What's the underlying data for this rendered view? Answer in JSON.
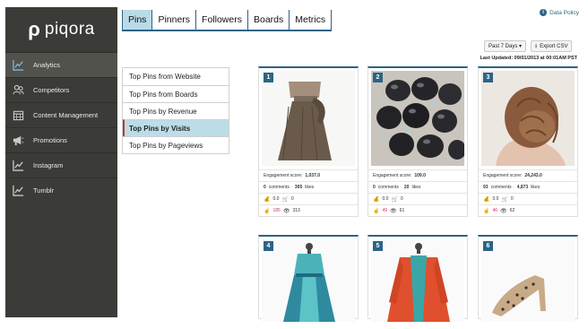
{
  "brand": {
    "logo_mark": "ρ",
    "logo_text": "piqora"
  },
  "sidebar": {
    "items": [
      {
        "label": "Analytics",
        "icon": "line-chart-icon",
        "active": true
      },
      {
        "label": "Competitors",
        "icon": "users-icon",
        "active": false
      },
      {
        "label": "Content Management",
        "icon": "calendar-icon",
        "active": false
      },
      {
        "label": "Promotions",
        "icon": "megaphone-icon",
        "active": false
      },
      {
        "label": "Instagram",
        "icon": "line-chart-icon",
        "active": false
      },
      {
        "label": "Tumblr",
        "icon": "line-chart-icon",
        "active": false
      }
    ]
  },
  "tabs": [
    {
      "label": "Pins",
      "active": true
    },
    {
      "label": "Pinners",
      "active": false
    },
    {
      "label": "Followers",
      "active": false
    },
    {
      "label": "Boards",
      "active": false
    },
    {
      "label": "Metrics",
      "active": false
    }
  ],
  "header": {
    "data_policy": "Data Policy"
  },
  "toolbar": {
    "range_select": "Past 7 Days ▾",
    "export_label": "Export CSV",
    "last_updated": "Last Updated: 09/01/2013 at 00:01AM PST"
  },
  "subnav": [
    {
      "label": "Top Pins from Website",
      "active": false
    },
    {
      "label": "Top Pins from Boards",
      "active": false
    },
    {
      "label": "Top Pins by Revenue",
      "active": false
    },
    {
      "label": "Top Pins by Visits",
      "active": true
    },
    {
      "label": "Top Pins by Pageviews",
      "active": false
    }
  ],
  "pins": [
    {
      "rank": "1",
      "engagement_label": "Engagement score:",
      "engagement": "1,037.0",
      "comments": "0",
      "comments_label": "comments ·",
      "likes": "305",
      "likes_label": "likes",
      "price": "0.0",
      "cart": "0",
      "clicks": "185",
      "views": "313"
    },
    {
      "rank": "2",
      "engagement_label": "Engagement score:",
      "engagement": "109.0",
      "comments": "0",
      "comments_label": "comments ·",
      "likes": "20",
      "likes_label": "likes",
      "price": "0.0",
      "cart": "0",
      "clicks": "49",
      "views": "61"
    },
    {
      "rank": "3",
      "engagement_label": "Engagement score:",
      "engagement": "24,243.0",
      "comments": "93",
      "comments_label": "comments ·",
      "likes": "4,873",
      "likes_label": "likes",
      "price": "0.0",
      "cart": "0",
      "clicks": "46",
      "views": "62"
    },
    {
      "rank": "4"
    },
    {
      "rank": "5"
    },
    {
      "rank": "6"
    }
  ]
}
